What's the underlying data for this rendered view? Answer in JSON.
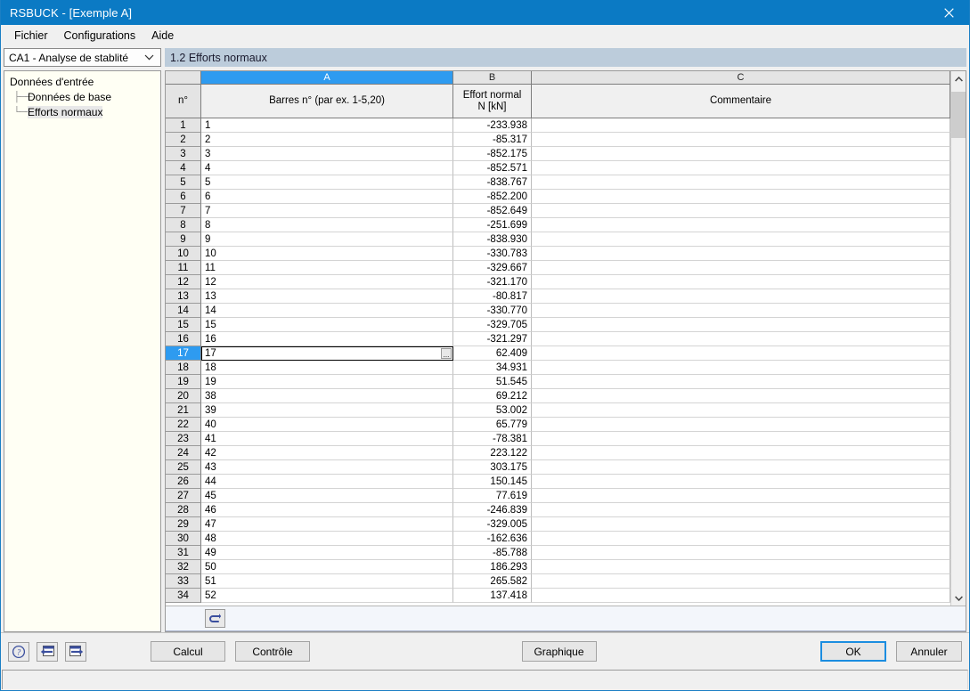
{
  "window": {
    "title": "RSBUCK - [Exemple A]",
    "close_icon": "close-icon",
    "accent": "#0b7ac4"
  },
  "menubar": {
    "items": [
      {
        "label": "Fichier"
      },
      {
        "label": "Configurations"
      },
      {
        "label": "Aide"
      }
    ]
  },
  "sidebar": {
    "combo": {
      "value": "CA1 - Analyse de stablité",
      "chevron": "chevron-down-icon"
    },
    "tree": {
      "root": "Données d'entrée",
      "children": [
        {
          "label": "Données de base",
          "selected": false
        },
        {
          "label": "Efforts normaux",
          "selected": true
        }
      ]
    }
  },
  "panel": {
    "header": "1.2 Efforts normaux"
  },
  "table": {
    "column_letters": [
      "A",
      "B",
      "C"
    ],
    "selected_column": "A",
    "rownum_header": "n°",
    "headers": [
      {
        "line1": "Barres n° (par ex. 1-5,20)",
        "line2": ""
      },
      {
        "line1": "Effort normal",
        "line2": "N [kN]"
      },
      {
        "line1": "Commentaire",
        "line2": ""
      }
    ],
    "selected_row": 17,
    "editing_cell_button": "...",
    "rows": [
      {
        "n": "1",
        "bar": "1",
        "n_kn": "-233.938",
        "comment": ""
      },
      {
        "n": "2",
        "bar": "2",
        "n_kn": "-85.317",
        "comment": ""
      },
      {
        "n": "3",
        "bar": "3",
        "n_kn": "-852.175",
        "comment": ""
      },
      {
        "n": "4",
        "bar": "4",
        "n_kn": "-852.571",
        "comment": ""
      },
      {
        "n": "5",
        "bar": "5",
        "n_kn": "-838.767",
        "comment": ""
      },
      {
        "n": "6",
        "bar": "6",
        "n_kn": "-852.200",
        "comment": ""
      },
      {
        "n": "7",
        "bar": "7",
        "n_kn": "-852.649",
        "comment": ""
      },
      {
        "n": "8",
        "bar": "8",
        "n_kn": "-251.699",
        "comment": ""
      },
      {
        "n": "9",
        "bar": "9",
        "n_kn": "-838.930",
        "comment": ""
      },
      {
        "n": "10",
        "bar": "10",
        "n_kn": "-330.783",
        "comment": ""
      },
      {
        "n": "11",
        "bar": "11",
        "n_kn": "-329.667",
        "comment": ""
      },
      {
        "n": "12",
        "bar": "12",
        "n_kn": "-321.170",
        "comment": ""
      },
      {
        "n": "13",
        "bar": "13",
        "n_kn": "-80.817",
        "comment": ""
      },
      {
        "n": "14",
        "bar": "14",
        "n_kn": "-330.770",
        "comment": ""
      },
      {
        "n": "15",
        "bar": "15",
        "n_kn": "-329.705",
        "comment": ""
      },
      {
        "n": "16",
        "bar": "16",
        "n_kn": "-321.297",
        "comment": ""
      },
      {
        "n": "17",
        "bar": "17",
        "n_kn": "62.409",
        "comment": ""
      },
      {
        "n": "18",
        "bar": "18",
        "n_kn": "34.931",
        "comment": ""
      },
      {
        "n": "19",
        "bar": "19",
        "n_kn": "51.545",
        "comment": ""
      },
      {
        "n": "20",
        "bar": "38",
        "n_kn": "69.212",
        "comment": ""
      },
      {
        "n": "21",
        "bar": "39",
        "n_kn": "53.002",
        "comment": ""
      },
      {
        "n": "22",
        "bar": "40",
        "n_kn": "65.779",
        "comment": ""
      },
      {
        "n": "23",
        "bar": "41",
        "n_kn": "-78.381",
        "comment": ""
      },
      {
        "n": "24",
        "bar": "42",
        "n_kn": "223.122",
        "comment": ""
      },
      {
        "n": "25",
        "bar": "43",
        "n_kn": "303.175",
        "comment": ""
      },
      {
        "n": "26",
        "bar": "44",
        "n_kn": "150.145",
        "comment": ""
      },
      {
        "n": "27",
        "bar": "45",
        "n_kn": "77.619",
        "comment": ""
      },
      {
        "n": "28",
        "bar": "46",
        "n_kn": "-246.839",
        "comment": ""
      },
      {
        "n": "29",
        "bar": "47",
        "n_kn": "-329.005",
        "comment": ""
      },
      {
        "n": "30",
        "bar": "48",
        "n_kn": "-162.636",
        "comment": ""
      },
      {
        "n": "31",
        "bar": "49",
        "n_kn": "-85.788",
        "comment": ""
      },
      {
        "n": "32",
        "bar": "50",
        "n_kn": "186.293",
        "comment": ""
      },
      {
        "n": "33",
        "bar": "51",
        "n_kn": "265.582",
        "comment": ""
      },
      {
        "n": "34",
        "bar": "52",
        "n_kn": "137.418",
        "comment": ""
      }
    ]
  },
  "grid_toolbar": {
    "reset_icon": "undo-arrow-icon"
  },
  "scrollbar": {
    "up_icon": "chevron-up-icon",
    "down_icon": "chevron-down-icon"
  },
  "bottombar": {
    "help_icon": "help-question-icon",
    "prev_icon": "navigate-back-icon",
    "next_icon": "navigate-forward-icon",
    "calcul_label": "Calcul",
    "controle_label": "Contrôle",
    "graphique_label": "Graphique",
    "ok_label": "OK",
    "annuler_label": "Annuler"
  },
  "statusbar": {
    "text": ""
  }
}
